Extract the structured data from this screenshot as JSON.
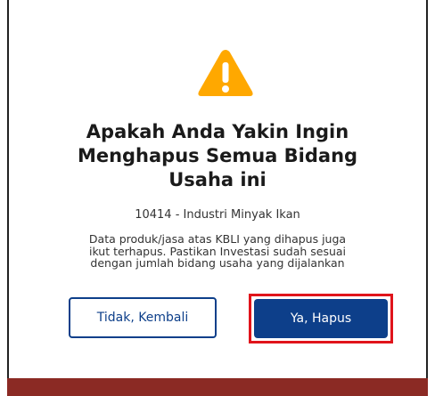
{
  "dialog": {
    "title_lines": [
      "Apakah Anda Yakin Ingin",
      "Menghapus Semua Bidang",
      "Usaha ini"
    ],
    "kbli": "10414 - Industri Minyak Ikan",
    "description_lines": [
      "Data produk/jasa atas KBLI yang dihapus juga",
      "ikut terhapus. Pastikan Investasi sudah sesuai",
      "dengan jumlah bidang usaha yang dijalankan"
    ],
    "cancel_label": "Tidak, Kembali",
    "confirm_label": "Ya, Hapus",
    "icon": "warning-triangle-icon"
  },
  "colors": {
    "warning": "#ffa800",
    "primary": "#0d3f8a",
    "highlight": "#e0141b",
    "background_band": "#8b2a24"
  }
}
